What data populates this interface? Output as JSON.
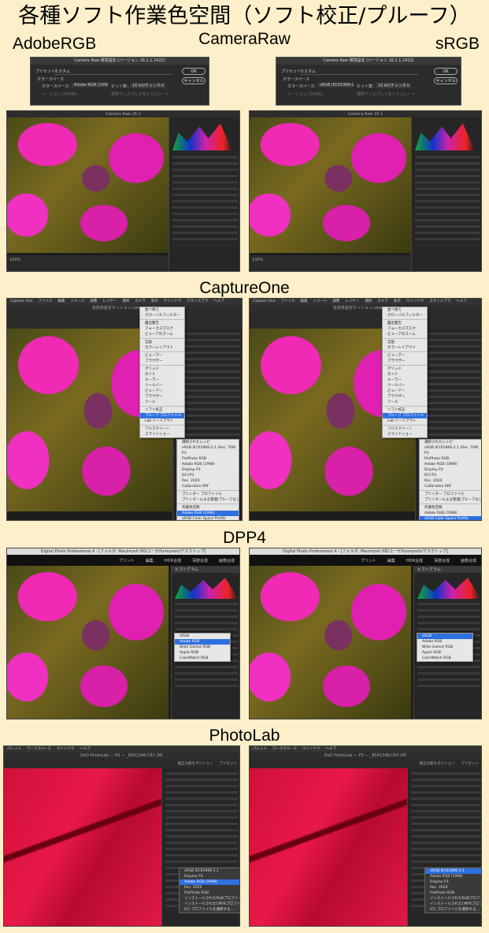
{
  "title": "各種ソフト作業色空間（ソフト校正/プルーフ）",
  "labels": {
    "left": "AdobeRGB",
    "right": "sRGB"
  },
  "camera_raw": {
    "label": "CameraRaw",
    "dialog": {
      "title": "Camera Raw 環境設定 (バージョン 16.1.1.2422)",
      "preset_label": "プリセット：",
      "preset_value": "カスタム",
      "colorspace_heading": "カラースペース",
      "colorspace_label": "カラースペース：",
      "bit_label": "ビット数：",
      "bit_value": "16 bit/チャンネル",
      "tone_label": "トーンマップ(HDR)：",
      "simulate_label": "標準ディスプレイをシミュレート",
      "ok": "OK",
      "cancel": "キャンセル"
    },
    "left_space": "Adobe RGB (1998)",
    "right_space": "sRGB IEC61966-2.1",
    "window_title": "Camera Raw 16.1",
    "zoom": "100%"
  },
  "capture_one": {
    "label": "CaptureOne",
    "menubar": [
      "Capture One",
      "ファイル",
      "編集",
      "イメージ",
      "調整",
      "レイヤー",
      "選択",
      "カメラ",
      "表示",
      "ウインドウ",
      "スタイルブラ",
      "ヘルプ"
    ],
    "window_title": "名前未設定セッション.cosessiondb",
    "menu": [
      "並べ替え",
      "グローバルフィルター",
      "",
      "露出警告",
      "フォーカスマスク",
      "ビューアのズーム",
      "",
      "全画",
      "カラーレイアウト",
      "",
      "ビューアー",
      "ブラウザー",
      "",
      "グリッド",
      "ガイド",
      "ルーラー",
      "ツールバー",
      "ビューアー",
      "ブラウザー",
      "ツール",
      "",
      "ソフト校正",
      "プルーフ プロファイル",
      "Lab リードアウト",
      "",
      "フルスクリーン",
      "スライドショー"
    ],
    "submenu": [
      "選択されたレシピ",
      "sRGB IEC61966-2.1 (Rec. 709)",
      "P3",
      "ProPhoto RGB",
      "Adobe RGB (1998)",
      "Display P3",
      "DCI-P3",
      "Rec. 2020",
      "Calibration RRF",
      "",
      "プリンター プロファイル",
      "プリンターによる管理(プルーフなし)",
      "",
      "作業色空間"
    ],
    "left_selected": "Adobe RGB (1998)",
    "right_selected": "sRGB Color Space Profile",
    "selected_other_left": "sRGB Color Space Profile",
    "selected_other_right": "Adobe RGB (1998)"
  },
  "dpp4": {
    "label": "DPP4",
    "window_title": "Digital Photo Professional 4 - [フォルダ: Macintosh HD/ユーザ/fumiyoshi/デスクトップ]",
    "toolbar": [
      "プリント",
      "編集",
      "HDR合成",
      "深度合成",
      "画像合成"
    ],
    "panel_title": "ヒストグラム",
    "options": [
      "sRGB",
      "Adobe RGB",
      "Wide Gamut RGB",
      "Apple RGB",
      "ColorMatch RGB"
    ],
    "left_selected": "Adobe RGB",
    "right_selected": "sRGB"
  },
  "photolab": {
    "label": "PhotoLab",
    "menubar": [
      "パレット",
      "ワークスペース",
      "ウインドウ",
      "ヘルプ"
    ],
    "window_title": "DxO PhotoLab — PS — _8541348.CR3 (M)",
    "toolbar_right": [
      "補正比較をポジション",
      "プリセット"
    ],
    "left_options": [
      "sRGB IEC61966-2.1",
      "Display P3",
      "Adobe RGB (1998)",
      "Rec. 2020",
      "ProPhoto RGB",
      "インストールされたRGBプロファイル",
      "インストールされたCMYKプロファイル",
      "ICC プロファイルを選択する…"
    ],
    "right_options": [
      "sRGB IEC61966-2.1",
      "Adobe RGB (1998)",
      "Display P3",
      "Rec. 2020",
      "ProPhoto RGB",
      "インストールされたRGBプロファイル",
      "インストールされたCMYKプロファイル",
      "ICC プロファイルを選択する…"
    ],
    "left_selected": "Adobe RGB (1998)",
    "right_selected": "sRGB IEC61966-2.1"
  },
  "colors": {
    "background": "#fdefc9",
    "accent": "#2f6fe0"
  }
}
